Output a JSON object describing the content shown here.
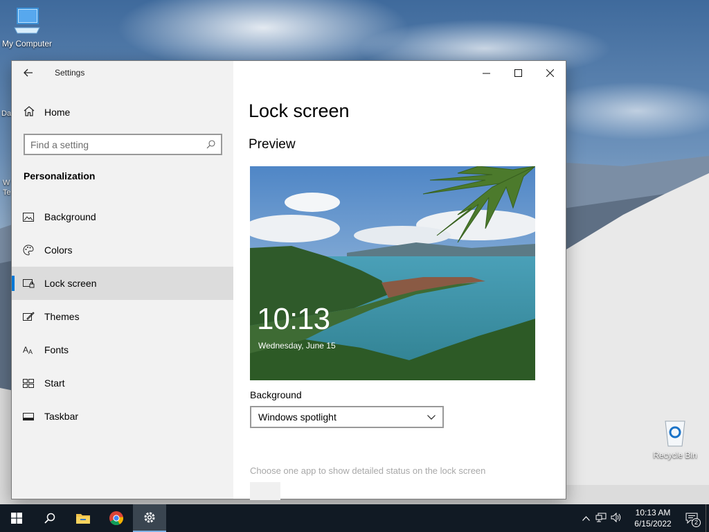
{
  "desktop": {
    "icons": [
      {
        "label": "My Computer",
        "icon": "computer-icon"
      },
      {
        "label": "Recycle Bin",
        "icon": "recycle-bin-icon"
      }
    ],
    "edge_text": [
      "Da",
      "W",
      "Te"
    ]
  },
  "window": {
    "app_title": "Settings",
    "home_label": "Home",
    "search_placeholder": "Find a setting",
    "section_title": "Personalization",
    "nav_items": [
      {
        "label": "Background",
        "icon": "picture-icon"
      },
      {
        "label": "Colors",
        "icon": "palette-icon"
      },
      {
        "label": "Lock screen",
        "icon": "lock-screen-icon",
        "selected": true
      },
      {
        "label": "Themes",
        "icon": "themes-icon"
      },
      {
        "label": "Fonts",
        "icon": "fonts-icon"
      },
      {
        "label": "Start",
        "icon": "start-icon"
      },
      {
        "label": "Taskbar",
        "icon": "taskbar-icon"
      }
    ],
    "page_title": "Lock screen",
    "preview_heading": "Preview",
    "preview": {
      "time": "10:13",
      "date": "Wednesday, June 15"
    },
    "background_label": "Background",
    "background_value": "Windows spotlight",
    "app_status_hint": "Choose one app to show detailed status on the lock screen",
    "accent_color": "#0078d7"
  },
  "taskbar": {
    "time": "10:13 AM",
    "date": "6/15/2022",
    "notification_count": "2",
    "pinned": [
      "start-icon",
      "search-icon",
      "file-explorer-icon",
      "chrome-icon",
      "settings-icon"
    ]
  }
}
